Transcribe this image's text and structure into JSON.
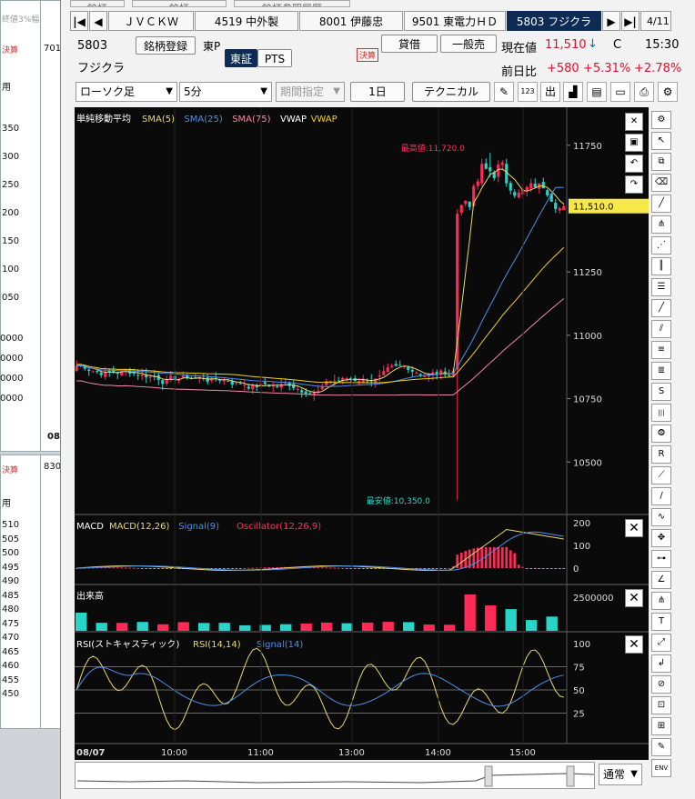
{
  "bg_left": {
    "top_numbers": [
      "350",
      "300",
      "250",
      "200",
      "150",
      "100",
      "050"
    ],
    "mid_numbers": [
      "0000",
      "0000",
      "0000",
      "0000"
    ],
    "bottom_numbers": [
      "510",
      "505",
      "500",
      "495",
      "490",
      "485",
      "480",
      "475",
      "470",
      "465",
      "460",
      "455",
      "450"
    ],
    "label_701": "701",
    "label_830": "830",
    "label_08": "08",
    "label_you": "用",
    "label_you2": "用",
    "label_kessan": "決算",
    "label_kessan2": "決算",
    "label_top": "終値3%幅"
  },
  "header": {
    "top_partial": [
      "銘柄",
      "銘柄",
      "銘柄参照履歴"
    ],
    "tabs": [
      {
        "label": "ＪＶＣＫＷ"
      },
      {
        "label": "4519 中外製"
      },
      {
        "label": "8001 伊藤忠"
      },
      {
        "label": "9501 東電力ＨＤ"
      },
      {
        "label": "5803 フジクラ"
      }
    ],
    "page_counter": "4/11"
  },
  "stock": {
    "code": "5803",
    "name": "フジクラ",
    "register_label": "銘柄登録",
    "market_label": "東P",
    "exchange_tse": "東証",
    "exchange_pts": "PTS",
    "kessan": "決算",
    "lend_label": "貸借",
    "general_label": "一般売",
    "price_label": "現在値",
    "price": "11,510",
    "price_arrow": "↓",
    "price_flag": "C",
    "time": "15:30",
    "change_label": "前日比",
    "change": "+580",
    "change_pct": "+5.31%",
    "change_pct2": "+2.78%"
  },
  "toolbar": {
    "chart_type": "ローソク足",
    "interval": "5分",
    "period": "期間指定",
    "span": "1日",
    "technical": "テクニカル"
  },
  "chart_data": {
    "type": "candlestick",
    "legend": {
      "title": "単純移動平均",
      "items": [
        {
          "name": "SMA(5)",
          "color": "#e8d96a"
        },
        {
          "name": "SMA(25)",
          "color": "#4f8ee8"
        },
        {
          "name": "SMA(75)",
          "color": "#f08aa8"
        },
        {
          "name": "VWAP",
          "color": "#ffffff"
        },
        {
          "name": "VWAP",
          "color": "#f0d020"
        }
      ]
    },
    "y_ticks": [
      11750,
      11500,
      11250,
      11000,
      10750,
      10500
    ],
    "y_tick_labels": [
      "11750",
      "11250",
      "11000",
      "10750",
      "10500"
    ],
    "ylim": [
      10300,
      11900
    ],
    "current_price_label": "11,510.0",
    "current_price": 11510,
    "high_label": "最高値:11,720.0",
    "high": 11720,
    "low_label": "最安値:10,350.0",
    "low": 10350,
    "x_labels": [
      "08/07",
      "10:00",
      "11:00",
      "13:00",
      "14:00",
      "15:00"
    ],
    "macd": {
      "title": "MACD",
      "items": [
        {
          "name": "MACD(12,26)",
          "color": "#e8d96a"
        },
        {
          "name": "Signal(9)",
          "color": "#4f8ee8"
        },
        {
          "name": "Oscillator(12,26,9)",
          "color": "#ff3060"
        }
      ],
      "y_labels": [
        "200",
        "100",
        "0"
      ]
    },
    "volume": {
      "title": "出来高",
      "y_label": "2500000"
    },
    "rsi": {
      "title": "RSI(ストキャスティック)",
      "items": [
        {
          "name": "RSI(14,14)",
          "color": "#e8d96a"
        },
        {
          "name": "Signal(14)",
          "color": "#4f8ee8"
        }
      ],
      "y_labels": [
        "100",
        "75",
        "50",
        "25"
      ]
    }
  },
  "footer": {
    "mode": "通常"
  },
  "colors": {
    "up": "#ff2a55",
    "down": "#27d6c8",
    "bg": "#0a0a0a",
    "grid": "#333333"
  }
}
